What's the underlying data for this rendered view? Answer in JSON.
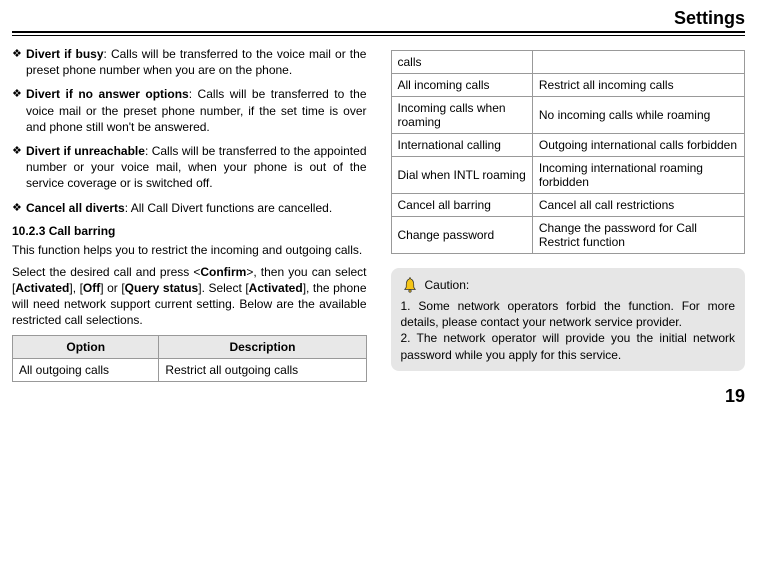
{
  "header": {
    "title": "Settings"
  },
  "bullets": [
    {
      "head": "Divert if busy",
      "body": ": Calls will be transferred to the voice mail or the preset phone number when you are on the phone."
    },
    {
      "head": "Divert if no answer options",
      "body": ": Calls will be transferred to the voice mail or the preset phone number, if the set time is over and phone still won't be answered."
    },
    {
      "head": "Divert if unreachable",
      "body": ": Calls will be transferred to the appointed number or your voice mail, when your phone is out of the service coverage or is switched off."
    },
    {
      "head": "Cancel all diverts",
      "body": ": All Call Divert functions are cancelled."
    }
  ],
  "section_heading": "10.2.3 Call barring",
  "intro": "This function helps you to restrict the incoming and outgoing calls.",
  "select_para_parts": {
    "p1": "Select the desired call and press <",
    "confirm": "Confirm",
    "p2": ">, then you can select [",
    "activated1": "Activated",
    "p3": "], [",
    "off": "Off",
    "p4": "] or [",
    "query": "Query status",
    "p5": "]. Select [",
    "activated2": "Activated",
    "p6": "], the phone will need network support current setting. Below are the available restricted call selections."
  },
  "table": {
    "headers": {
      "option": "Option",
      "description": "Description"
    },
    "rows_left": [
      {
        "option": "All outgoing calls",
        "description": "Restrict all outgoing calls"
      }
    ],
    "rows_right": [
      {
        "option": "All incoming calls",
        "description": "Restrict all incoming calls"
      },
      {
        "option": "Incoming calls when roaming",
        "description": "No incoming calls while roaming"
      },
      {
        "option": "International calling",
        "description": "Outgoing international calls forbidden"
      },
      {
        "option": "Dial when INTL roaming",
        "description": "Incoming international roaming forbidden"
      },
      {
        "option": "Cancel all barring",
        "description": "Cancel all call restrictions"
      },
      {
        "option": "Change password",
        "description": "Change the password for Call Restrict function"
      }
    ],
    "carry_cell": "calls"
  },
  "caution": {
    "label": "Caution:",
    "line1": "1.  Some network operators forbid the function. For more details, please contact your network service provider.",
    "line2": "2. The network operator will provide you the initial network password while you apply for this service."
  },
  "page_number": "19"
}
